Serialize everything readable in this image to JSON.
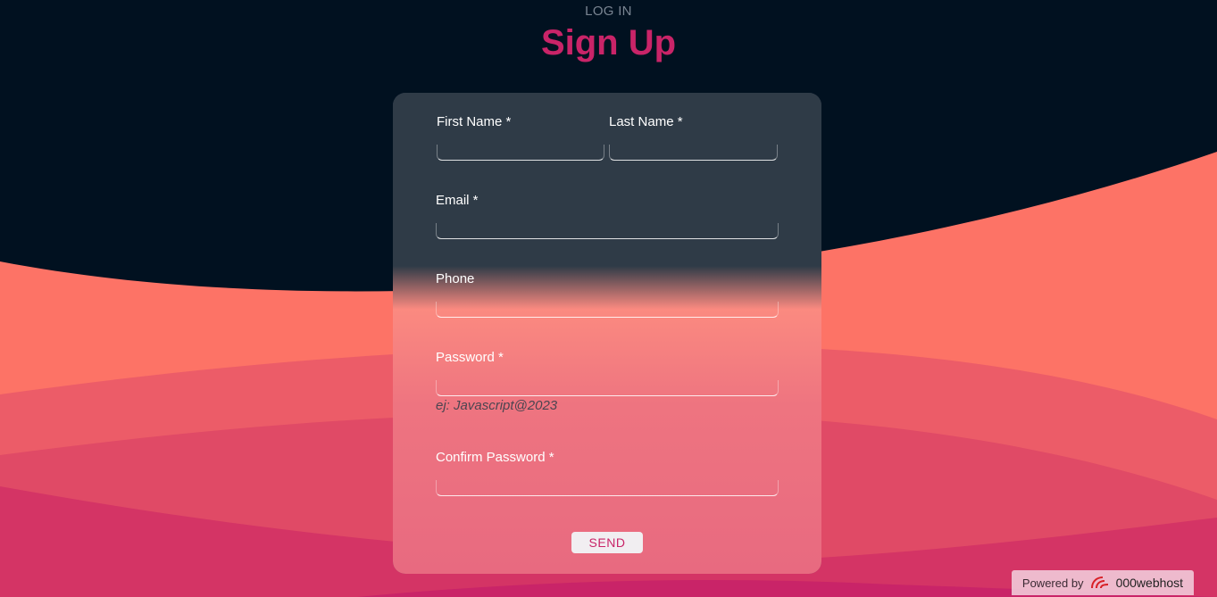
{
  "nav": {
    "login_label": "LOG IN"
  },
  "page": {
    "title": "Sign Up"
  },
  "form": {
    "first_name_label": "First Name *",
    "first_name_value": "",
    "last_name_label": "Last Name *",
    "last_name_value": "",
    "email_label": "Email *",
    "email_value": "",
    "phone_label": "Phone",
    "phone_value": "",
    "password_label": "Password *",
    "password_value": "",
    "password_hint": "ej: Javascript@2023",
    "confirm_password_label": "Confirm Password *",
    "confirm_password_value": "",
    "send_label": "SEND"
  },
  "footer": {
    "powered_by": "Powered by",
    "brand": "000webhost"
  },
  "colors": {
    "background": "#011120",
    "accent": "#c92468",
    "wave_1": "#fd7366",
    "wave_2": "#ec5c68",
    "wave_3": "#e04a66",
    "wave_4": "#d43465"
  }
}
